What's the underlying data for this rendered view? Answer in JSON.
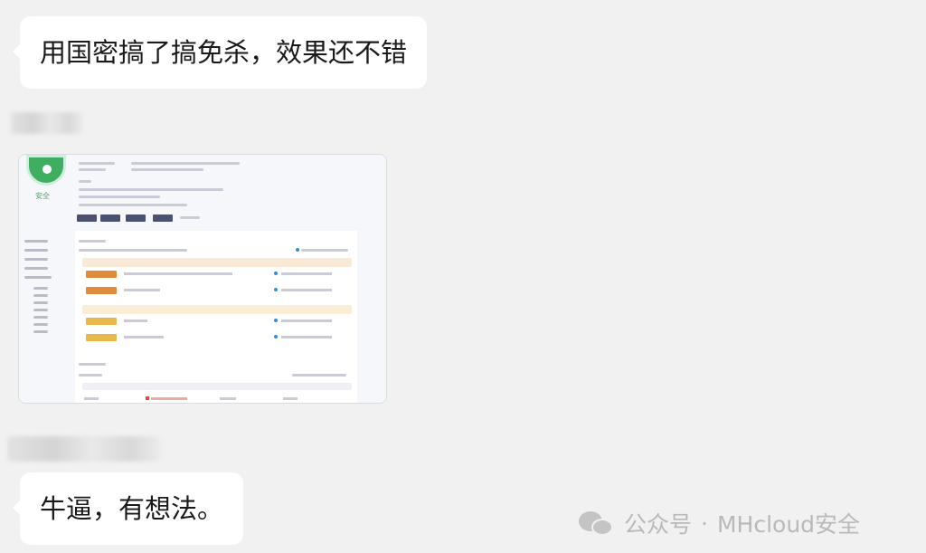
{
  "messages": [
    {
      "text": "用国密搞了搞免杀，效果还不错"
    },
    {
      "text": "牛逼，有想法。"
    }
  ],
  "thumbnail": {
    "safe_label": "安全"
  },
  "watermark": {
    "platform": "公众号",
    "separator": "·",
    "account": "MHcloud安全"
  },
  "colors": {
    "chat_bg": "#f1f1f1",
    "bubble_bg": "#ffffff",
    "safe_green": "#3fae60",
    "watermark_gray": "#b9b9b9"
  }
}
